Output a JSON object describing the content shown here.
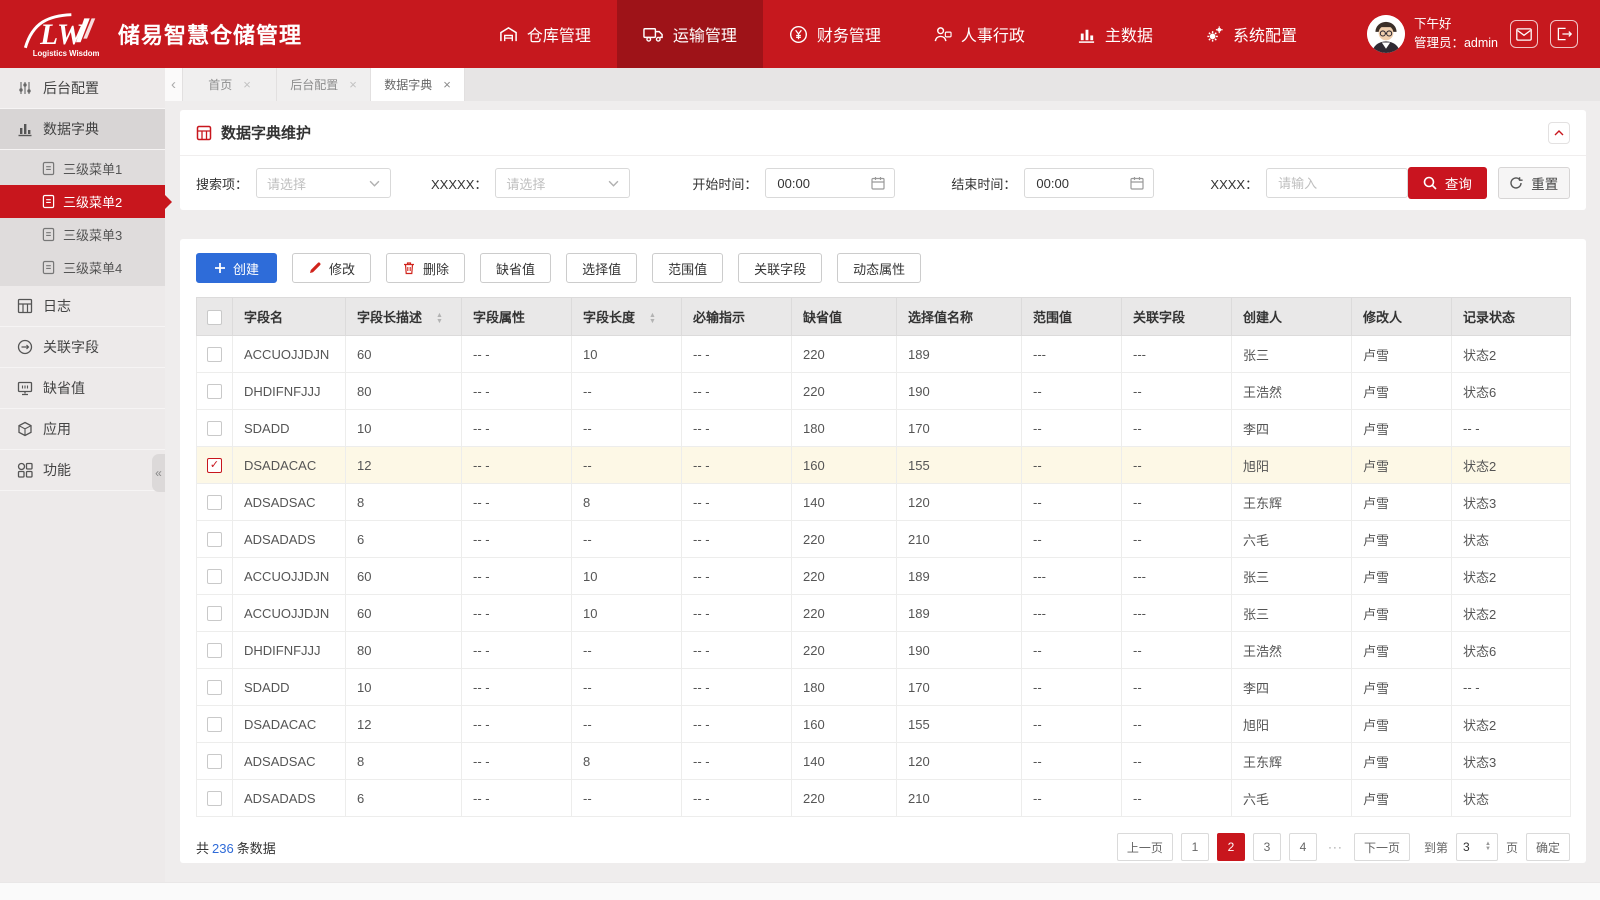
{
  "header": {
    "logo": {
      "brand_mark": "LW",
      "brand_sub": "Logistics Wisdom"
    },
    "app_title": "储易智慧仓储管理",
    "nav": [
      {
        "label": "仓库管理",
        "icon": "warehouse-icon",
        "active": false
      },
      {
        "label": "运输管理",
        "icon": "truck-icon",
        "active": true
      },
      {
        "label": "财务管理",
        "icon": "finance-icon",
        "active": false
      },
      {
        "label": "人事行政",
        "icon": "hr-icon",
        "active": false
      },
      {
        "label": "主数据",
        "icon": "bar-chart-icon",
        "active": false
      },
      {
        "label": "系统配置",
        "icon": "gear-icon",
        "active": false
      }
    ],
    "user": {
      "greeting": "下午好",
      "role_line": "管理员：admin"
    },
    "actions": [
      {
        "icon": "mail-icon"
      },
      {
        "icon": "logout-icon"
      }
    ]
  },
  "tabs": {
    "back_glyph": "‹",
    "close_glyph": "×",
    "items": [
      {
        "label": "首页",
        "active": false
      },
      {
        "label": "后台配置",
        "active": false
      },
      {
        "label": "数据字典",
        "active": true
      }
    ]
  },
  "sidebar": {
    "collapse_glyph": "«",
    "items": [
      {
        "label": "后台配置",
        "icon": "sliders-icon"
      },
      {
        "label": "数据字典",
        "icon": "bar-chart-icon",
        "expanded": true,
        "children": [
          {
            "label": "三级菜单1",
            "active": false
          },
          {
            "label": "三级菜单2",
            "active": true
          },
          {
            "label": "三级菜单3",
            "active": false
          },
          {
            "label": "三级菜单4",
            "active": false
          }
        ]
      },
      {
        "label": "日志",
        "icon": "grid-icon"
      },
      {
        "label": "关联字段",
        "icon": "link-icon"
      },
      {
        "label": "缺省值",
        "icon": "monitor-icon"
      },
      {
        "label": "应用",
        "icon": "cube-icon"
      },
      {
        "label": "功能",
        "icon": "components-icon"
      }
    ]
  },
  "panel": {
    "title": "数据字典维护"
  },
  "filters": {
    "search_label": "搜索项：",
    "search_placeholder": "请选择",
    "xxxxx_label": "XXXXX：",
    "xxxxx_placeholder": "请选择",
    "start_label": "开始时间：",
    "start_value": "00:00",
    "end_label": "结束时间：",
    "end_value": "00:00",
    "xxxx_label": "XXXX：",
    "xxxx_placeholder": "请输入",
    "query_label": "查询",
    "reset_label": "重置"
  },
  "toolbar": {
    "create": "创建",
    "modify": "修改",
    "delete": "删除",
    "default_value": "缺省值",
    "select_value": "选择值",
    "range_value": "范围值",
    "related_field": "关联字段",
    "dynamic_attr": "动态属性"
  },
  "table": {
    "columns": [
      {
        "label": "字段名",
        "sortable": false
      },
      {
        "label": "字段长描述",
        "sortable": true
      },
      {
        "label": "字段属性",
        "sortable": false
      },
      {
        "label": "字段长度",
        "sortable": true
      },
      {
        "label": "必输指示",
        "sortable": false
      },
      {
        "label": "缺省值",
        "sortable": false
      },
      {
        "label": "选择值名称",
        "sortable": false
      },
      {
        "label": "范围值",
        "sortable": false
      },
      {
        "label": "关联字段",
        "sortable": false
      },
      {
        "label": "创建人",
        "sortable": false
      },
      {
        "label": "修改人",
        "sortable": false
      },
      {
        "label": "记录状态",
        "sortable": false
      }
    ],
    "rows": [
      {
        "checked": false,
        "cells": [
          "ACCUOJJDJN",
          "60",
          "-- -",
          "10",
          "-- -",
          "220",
          "189",
          "---",
          "---",
          "张三",
          "卢雪",
          "状态2"
        ]
      },
      {
        "checked": false,
        "cells": [
          "DHDIFNFJJJ",
          "80",
          "-- -",
          "--",
          "-- -",
          "220",
          "190",
          "--",
          "--",
          "王浩然",
          "卢雪",
          "状态6"
        ]
      },
      {
        "checked": false,
        "cells": [
          "SDADD",
          "10",
          "-- -",
          "--",
          "-- -",
          "180",
          "170",
          "--",
          "--",
          "李四",
          "卢雪",
          "-- -"
        ]
      },
      {
        "checked": true,
        "cells": [
          "DSADACAC",
          "12",
          "-- -",
          "--",
          "-- -",
          "160",
          "155",
          "--",
          "--",
          "旭阳",
          "卢雪",
          "状态2"
        ]
      },
      {
        "checked": false,
        "cells": [
          "ADSADSAC",
          "8",
          "-- -",
          "8",
          "-- -",
          "140",
          "120",
          "--",
          "--",
          "王东辉",
          "卢雪",
          "状态3"
        ]
      },
      {
        "checked": false,
        "cells": [
          "ADSADADS",
          "6",
          "-- -",
          "--",
          "-- -",
          "220",
          "210",
          "--",
          "--",
          "六毛",
          "卢雪",
          "状态"
        ]
      },
      {
        "checked": false,
        "cells": [
          "ACCUOJJDJN",
          "60",
          "-- -",
          "10",
          "-- -",
          "220",
          "189",
          "---",
          "---",
          "张三",
          "卢雪",
          "状态2"
        ]
      },
      {
        "checked": false,
        "cells": [
          "ACCUOJJDJN",
          "60",
          "-- -",
          "10",
          "-- -",
          "220",
          "189",
          "---",
          "---",
          "张三",
          "卢雪",
          "状态2"
        ]
      },
      {
        "checked": false,
        "cells": [
          "DHDIFNFJJJ",
          "80",
          "-- -",
          "--",
          "-- -",
          "220",
          "190",
          "--",
          "--",
          "王浩然",
          "卢雪",
          "状态6"
        ]
      },
      {
        "checked": false,
        "cells": [
          "SDADD",
          "10",
          "-- -",
          "--",
          "-- -",
          "180",
          "170",
          "--",
          "--",
          "李四",
          "卢雪",
          "-- -"
        ]
      },
      {
        "checked": false,
        "cells": [
          "DSADACAC",
          "12",
          "-- -",
          "--",
          "-- -",
          "160",
          "155",
          "--",
          "--",
          "旭阳",
          "卢雪",
          "状态2"
        ]
      },
      {
        "checked": false,
        "cells": [
          "ADSADSAC",
          "8",
          "-- -",
          "8",
          "-- -",
          "140",
          "120",
          "--",
          "--",
          "王东辉",
          "卢雪",
          "状态3"
        ]
      },
      {
        "checked": false,
        "cells": [
          "ADSADADS",
          "6",
          "-- -",
          "--",
          "-- -",
          "220",
          "210",
          "--",
          "--",
          "六毛",
          "卢雪",
          "状态"
        ]
      }
    ]
  },
  "pagination": {
    "total_prefix": "共",
    "total_count": "236",
    "total_suffix": "条数据",
    "prev": "上一页",
    "pages": [
      "1",
      "2",
      "3",
      "4"
    ],
    "active_page": "2",
    "ellipsis": "···",
    "next": "下一页",
    "goto_prefix": "到第",
    "goto_value": "3",
    "goto_suffix": "页",
    "confirm": "确定"
  },
  "colors": {
    "brand_red": "#c6181e",
    "active_red": "#c8161d",
    "nav_active_red": "#9e1318",
    "primary_blue": "#2e6cd9",
    "link_blue": "#2f6bd8",
    "selected_row": "#fdf8e6"
  }
}
